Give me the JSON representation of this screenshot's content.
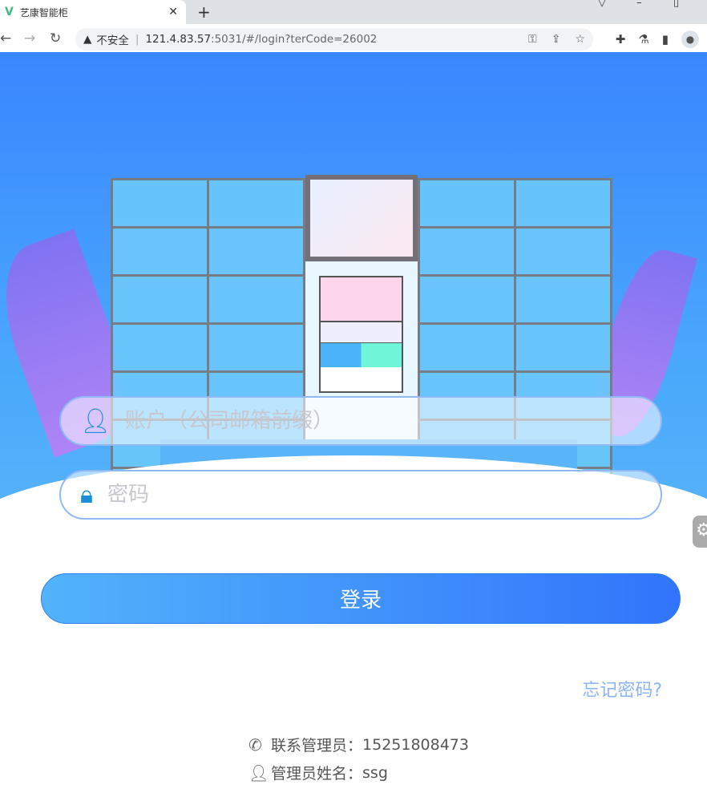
{
  "browser": {
    "tab_title": "艺康智能柜",
    "url_host": "121.4.83.57",
    "url_rest": ":5031/#/login?terCode=26002",
    "security_label": "不安全"
  },
  "login": {
    "account_placeholder": "账户（公司邮箱前缀）",
    "password_placeholder": "密码",
    "submit_label": "登录",
    "forgot_label": "忘记密码?"
  },
  "contact": {
    "phone_label": "联系管理员：",
    "phone_value": "15251808473",
    "name_label": "管理员姓名：",
    "name_value": "ssg"
  },
  "colors": {
    "accent": "#3a86ff",
    "link": "#8ab4f8"
  }
}
